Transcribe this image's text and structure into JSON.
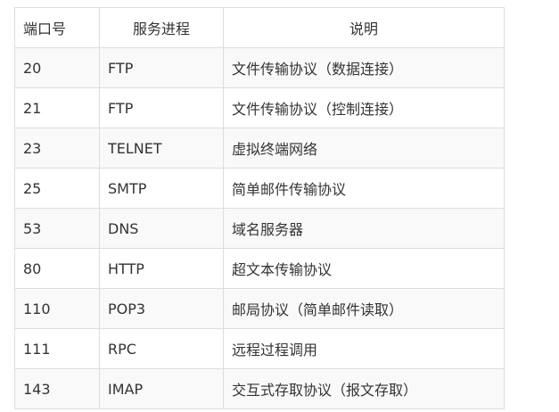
{
  "table": {
    "headers": [
      "端口号",
      "服务进程",
      "说明"
    ],
    "rows": [
      {
        "port": "20",
        "service": "FTP",
        "desc": "文件传输协议（数据连接）"
      },
      {
        "port": "21",
        "service": "FTP",
        "desc": "文件传输协议（控制连接）"
      },
      {
        "port": "23",
        "service": "TELNET",
        "desc": "虚拟终端网络"
      },
      {
        "port": "25",
        "service": "SMTP",
        "desc": "简单邮件传输协议"
      },
      {
        "port": "53",
        "service": "DNS",
        "desc": "域名服务器"
      },
      {
        "port": "80",
        "service": "HTTP",
        "desc": "超文本传输协议"
      },
      {
        "port": "110",
        "service": "POP3",
        "desc": "邮局协议（简单邮件读取）"
      },
      {
        "port": "111",
        "service": "RPC",
        "desc": "远程过程调用"
      },
      {
        "port": "143",
        "service": "IMAP",
        "desc": "交互式存取协议（报文存取）"
      }
    ]
  }
}
